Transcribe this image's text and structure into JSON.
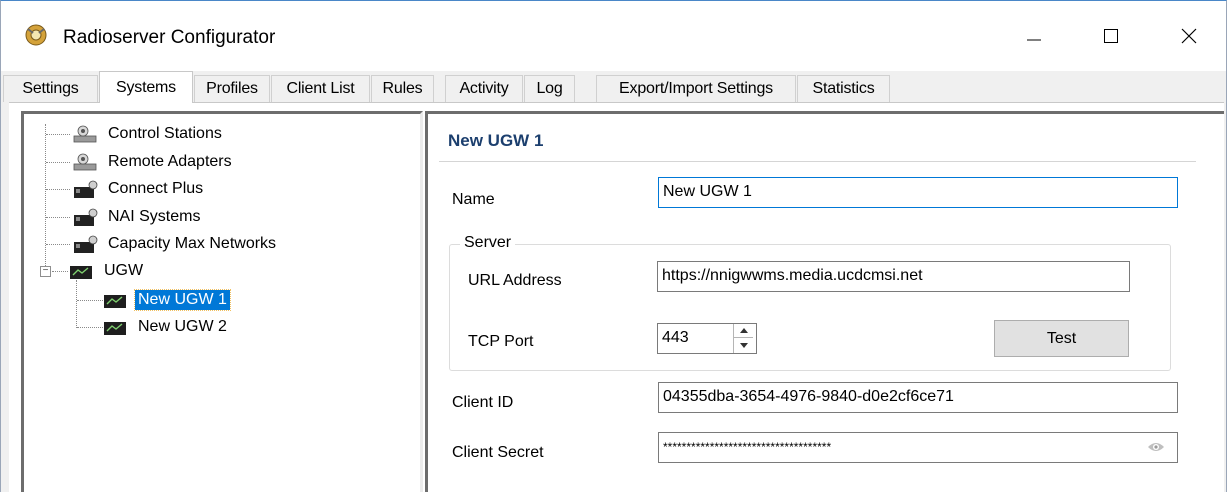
{
  "window": {
    "title": "Radioserver Configurator",
    "accent_color": "#0078d7",
    "app_icon": "radioserver-app-icon"
  },
  "tabs": [
    {
      "label": "Settings"
    },
    {
      "label": "Systems",
      "active": true
    },
    {
      "label": "Profiles"
    },
    {
      "label": "Client List"
    },
    {
      "label": "Rules"
    },
    {
      "label": "Activity"
    },
    {
      "label": "Log"
    },
    {
      "label": "Export/Import Settings"
    },
    {
      "label": "Statistics"
    }
  ],
  "tree": {
    "items": [
      {
        "label": "Control Stations",
        "icon": "radio-station-icon"
      },
      {
        "label": "Remote Adapters",
        "icon": "radio-station-icon"
      },
      {
        "label": "Connect Plus",
        "icon": "network-system-icon"
      },
      {
        "label": "NAI Systems",
        "icon": "network-system-icon"
      },
      {
        "label": "Capacity Max Networks",
        "icon": "network-system-icon"
      },
      {
        "label": "UGW",
        "icon": "gateway-icon",
        "expanded": true
      },
      {
        "label": "New UGW 1",
        "icon": "gateway-icon",
        "selected": true
      },
      {
        "label": "New UGW 2",
        "icon": "gateway-icon"
      }
    ]
  },
  "panel": {
    "title": "New UGW 1",
    "name_label": "Name",
    "name_value": "New UGW 1",
    "server": {
      "group_title": "Server",
      "url_label": "URL Address",
      "url_value": "https://nnigwwms.media.ucdcmsi.net",
      "port_label": "TCP Port",
      "port_value": "443",
      "test_label": "Test"
    },
    "client_id_label": "Client ID",
    "client_id_value": "04355dba-3654-4976-9840-d0e2cf6ce71",
    "client_secret_label": "Client Secret",
    "client_secret_value": "************************************"
  }
}
